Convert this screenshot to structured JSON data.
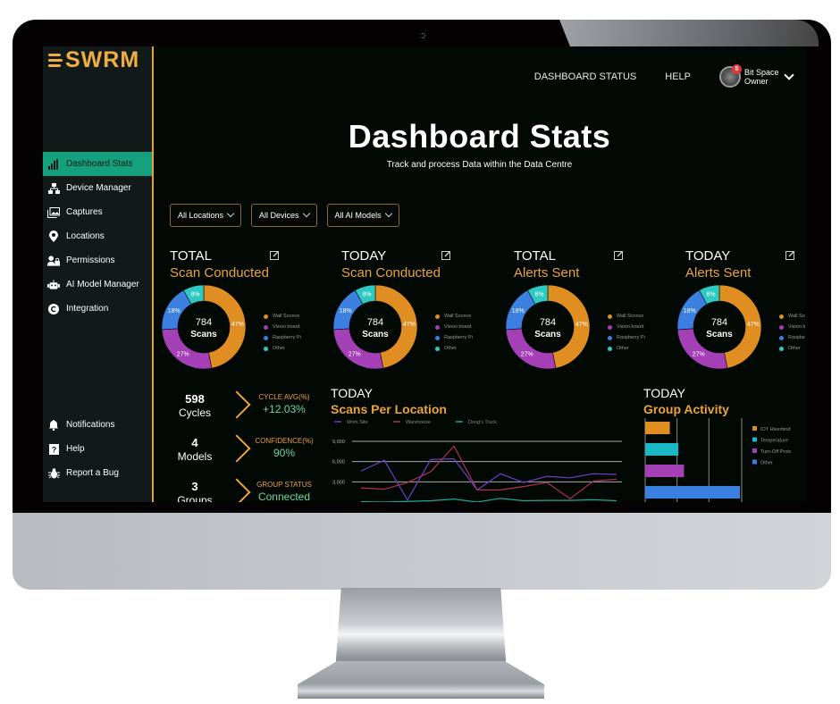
{
  "app": {
    "logo_text": "SWRM"
  },
  "sidebar": {
    "items": [
      {
        "label": "Dashboard Stats",
        "icon": "bar-chart-icon",
        "active": true
      },
      {
        "label": "Device Manager",
        "icon": "network-icon",
        "active": false
      },
      {
        "label": "Captures",
        "icon": "image-gallery-icon",
        "active": false
      },
      {
        "label": "Locations",
        "icon": "map-pin-icon",
        "active": false
      },
      {
        "label": "Permissions",
        "icon": "user-lock-icon",
        "active": false
      },
      {
        "label": "AI Model Manager",
        "icon": "robot-icon",
        "active": false
      },
      {
        "label": "Integration",
        "icon": "integration-icon",
        "active": false
      }
    ],
    "bottom_items": [
      {
        "label": "Notifications",
        "icon": "bell-icon"
      },
      {
        "label": "Help",
        "icon": "question-icon"
      },
      {
        "label": "Report a Bug",
        "icon": "bug-icon"
      }
    ]
  },
  "header": {
    "links": [
      "DASHBOARD STATUS",
      "HELP"
    ],
    "user": {
      "name_line1": "Bit Space",
      "name_line2": "Owner",
      "notification_count": "5"
    },
    "title": "Dashboard Stats",
    "subtitle": "Track and process Data within the Data Centre"
  },
  "filters": [
    {
      "label": "All Locations"
    },
    {
      "label": "All Devices"
    },
    {
      "label": "All AI Models"
    }
  ],
  "colors": {
    "accent": "#eca33a",
    "active_nav": "#14a07d",
    "wall_sconce": "#e08e22",
    "vision_board": "#a43fb5",
    "raspberry_pi": "#3b7fe0",
    "other": "#2ec9c0",
    "positive": "#6fd6a0"
  },
  "donut_cards": [
    {
      "kicker": "TOTAL",
      "title": "Scan Conducted",
      "center_value": "784",
      "center_label": "Scans"
    },
    {
      "kicker": "TODAY",
      "title": "Scan Conducted",
      "center_value": "784",
      "center_label": "Scans"
    },
    {
      "kicker": "TOTAL",
      "title": "Alerts Sent",
      "center_value": "784",
      "center_label": "Scans"
    },
    {
      "kicker": "TODAY",
      "title": "Alerts Sent",
      "center_value": "784",
      "center_label": "Scans"
    }
  ],
  "donut_legend": [
    "Wall Sconce",
    "Vision board",
    "Raspberry Pi",
    "Other"
  ],
  "stats": [
    {
      "value": "598",
      "label": "Cycles",
      "key": "CYCLE AVG(%)",
      "metric": "+12.03%"
    },
    {
      "value": "4",
      "label": "Models",
      "key": "CONFIDENCE(%)",
      "metric": "90%"
    },
    {
      "value": "3",
      "label": "Groups",
      "key": "GROUP STATUS",
      "metric": "Connected"
    }
  ],
  "chart_data": [
    {
      "type": "pie",
      "title": "Scan Conducted",
      "categories": [
        "Wall Sconce",
        "Vision board",
        "Raspberry Pi",
        "Other"
      ],
      "values": [
        47,
        27,
        18,
        8
      ],
      "labels": [
        "47%",
        "27%",
        "18%",
        "8%"
      ],
      "donut": true
    },
    {
      "type": "line",
      "title": "Scans Per Location",
      "kicker": "TODAY",
      "series": [
        {
          "name": "Work Site",
          "color": "#6a3fc0",
          "values": [
            4600,
            6200,
            300,
            6300,
            6400,
            1800,
            4200,
            2900,
            3800,
            3600,
            4200,
            4100
          ]
        },
        {
          "name": "Warehouse",
          "color": "#b0305a",
          "values": [
            2100,
            1900,
            2900,
            4500,
            8300,
            1800,
            1800,
            2300,
            2900,
            500,
            3100,
            3400
          ]
        },
        {
          "name": "Doug's Truck",
          "color": "#1ea79a",
          "values": [
            50,
            0,
            100,
            200,
            450,
            0,
            550,
            200,
            250,
            250,
            350,
            200
          ]
        }
      ],
      "yticks": [
        "9,000",
        "6,000",
        "3,000"
      ],
      "ylim": [
        0,
        9000
      ],
      "grid": true,
      "legend": "top"
    },
    {
      "type": "bar",
      "title": "Group Activity",
      "kicker": "TODAY",
      "orientation": "horizontal",
      "categories": [
        "IOT Hivemind",
        "Temperature",
        "Turn-Off Protc",
        "Other"
      ],
      "values": [
        26,
        35,
        41,
        100
      ],
      "colors": [
        "#e08e22",
        "#19b8c4",
        "#a43fb5",
        "#3b7fe0"
      ],
      "grid": true,
      "legend": "right"
    }
  ]
}
